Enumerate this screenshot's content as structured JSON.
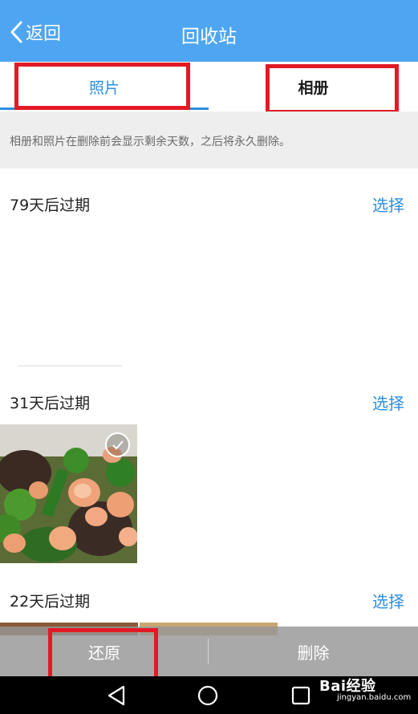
{
  "header": {
    "back_label": "返回",
    "title": "回收站"
  },
  "tabs": [
    {
      "label": "照片",
      "active": true
    },
    {
      "label": "相册",
      "active": false
    }
  ],
  "notice": "相册和照片在删除前会显示剩余天数，之后将永久删除。",
  "sections": [
    {
      "title": "79天后过期",
      "select_label": "选择"
    },
    {
      "title": "31天后过期",
      "select_label": "选择"
    },
    {
      "title": "22天后过期",
      "select_label": "选择"
    }
  ],
  "bottom_actions": {
    "restore_label": "还原",
    "delete_label": "删除"
  },
  "watermark": {
    "main": "Bai经验",
    "sub": "jingyan.baidu.com"
  },
  "colors": {
    "header_bg": "#4ea6f2",
    "accent": "#2d8fe0",
    "highlight_box": "#e21a26"
  },
  "icons": [
    "back-chevron-icon",
    "check-circle-icon",
    "nav-back-icon",
    "nav-home-icon",
    "nav-recents-icon",
    "baidu-paw-icon"
  ]
}
